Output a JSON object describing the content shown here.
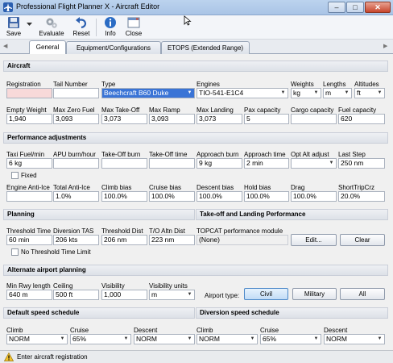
{
  "window": {
    "title": "Professional Flight Planner X - Aircraft Editor"
  },
  "toolbar": {
    "save": "Save",
    "evaluate": "Evaluate",
    "reset": "Reset",
    "info": "Info",
    "close": "Close"
  },
  "tabs": [
    "General",
    "Equipment/Configurations",
    "ETOPS (Extended Range)"
  ],
  "aircraft": {
    "header": "Aircraft",
    "labels": {
      "registration": "Registration",
      "tail_number": "Tail Number",
      "type": "Type",
      "engines": "Engines",
      "weights": "Weights",
      "lengths": "Lengths",
      "altitudes": "Altitudes",
      "empty_weight": "Empty Weight",
      "max_zero_fuel": "Max Zero Fuel",
      "max_takeoff": "Max Take-Off",
      "max_ramp": "Max Ramp",
      "max_landing": "Max Landing",
      "pax_capacity": "Pax capacity",
      "cargo_capacity": "Cargo capacity",
      "fuel_capacity": "Fuel capacity"
    },
    "values": {
      "registration": "",
      "tail_number": "",
      "type": "Beechcraft B60 Duke",
      "engines": "TIO-541-E1C4",
      "weights": "kg",
      "lengths": "m",
      "altitudes": "ft",
      "empty_weight": "1,940",
      "max_zero_fuel": "3,093",
      "max_takeoff": "3,073",
      "max_ramp": "3,093",
      "max_landing": "3,073",
      "pax_capacity": "5",
      "cargo_capacity": "",
      "fuel_capacity": "620"
    }
  },
  "performance": {
    "header": "Performance adjustments",
    "labels": {
      "taxi_fuel": "Taxi Fuel/min",
      "apu_burn": "APU burn/hour",
      "takeoff_burn": "Take-Off burn",
      "takeoff_time": "Take-Off time",
      "approach_burn": "Approach burn",
      "approach_time": "Approach time",
      "opt_alt_adjust": "Opt Alt adjust",
      "last_step": "Last Step",
      "fixed": "Fixed",
      "engine_anti_ice": "Engine Anti-Ice",
      "total_anti_ice": "Total Anti-Ice",
      "climb_bias": "Climb bias",
      "cruise_bias": "Cruise bias",
      "descent_bias": "Descent bias",
      "hold_bias": "Hold bias",
      "drag": "Drag",
      "short_trip_crz": "ShortTripCrz"
    },
    "values": {
      "taxi_fuel": "6 kg",
      "apu_burn": "",
      "takeoff_burn": "",
      "takeoff_time": "",
      "approach_burn": "9 kg",
      "approach_time": "2 min",
      "opt_alt_adjust": "",
      "last_step": "250 nm",
      "engine_anti_ice": "",
      "total_anti_ice": "1.0%",
      "climb_bias": "100.0%",
      "cruise_bias": "100.0%",
      "descent_bias": "100.0%",
      "hold_bias": "100.0%",
      "drag": "100.0%",
      "short_trip_crz": "20.0%"
    }
  },
  "planning": {
    "header": "Planning",
    "labels": {
      "threshold_time": "Threshold Time",
      "diversion_tas": "Diversion TAS",
      "threshold_dist": "Threshold Dist",
      "to_altn_dist": "T/O Altn Dist",
      "no_threshold_limit": "No Threshold Time Limit"
    },
    "values": {
      "threshold_time": "60 min",
      "diversion_tas": "206 kts",
      "threshold_dist": "206 nm",
      "to_altn_dist": "223 nm"
    }
  },
  "takeoff_landing": {
    "header": "Take-off and Landing Performance",
    "module_label": "TOPCAT performance module",
    "module_value": "(None)",
    "edit_button": "Edit...",
    "clear_button": "Clear"
  },
  "alternate": {
    "header": "Alternate airport planning",
    "labels": {
      "min_rwy": "Min Rwy length",
      "ceiling": "Ceiling",
      "visibility": "Visibility",
      "visibility_units": "Visibility units",
      "airport_type": "Airport type:"
    },
    "values": {
      "min_rwy": "640 m",
      "ceiling": "500 ft",
      "visibility": "1,000",
      "visibility_units": "m"
    },
    "airport_type_buttons": [
      "Civil",
      "Military",
      "All"
    ]
  },
  "speed_default": {
    "header": "Default speed schedule",
    "labels": {
      "climb": "Climb",
      "cruise": "Cruise",
      "descent": "Descent"
    },
    "values": {
      "climb": "NORM",
      "cruise": "65%",
      "descent": "NORM"
    }
  },
  "speed_diversion": {
    "header": "Diversion speed schedule",
    "labels": {
      "climb": "Climb",
      "cruise": "Cruise",
      "descent": "Descent"
    },
    "values": {
      "climb": "NORM",
      "cruise": "65%",
      "descent": "NORM"
    }
  },
  "status": {
    "message": "Enter aircraft registration"
  },
  "icons": {
    "app": "airplane-icon",
    "save": "floppy-disk-icon",
    "save_dropdown": "chevron-down-icon",
    "evaluate": "gears-icon",
    "reset": "undo-arrow-icon",
    "info": "info-icon",
    "close": "close-window-icon",
    "status": "warning-icon"
  },
  "colors": {
    "selected_field": "#3a74d6",
    "required_field": "#f8d9d9",
    "section_bg": "#e4e7ed"
  }
}
